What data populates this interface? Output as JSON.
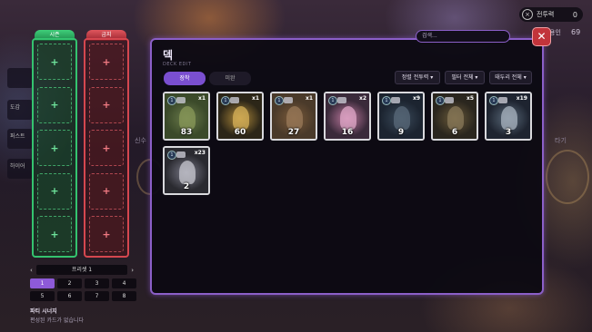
{
  "hud": {
    "currency_label": "전투력",
    "currency_value": "0",
    "side_label": "용인",
    "side_value": "69",
    "side_mid": "신수",
    "side_right": "타기"
  },
  "side_menu": [
    "",
    "도감",
    "퍼스트",
    "하이어"
  ],
  "columns": {
    "left_label": "시즌",
    "right_label": "금지",
    "slot_symbol": "+",
    "slot_count": 5
  },
  "preset": {
    "prev": "‹",
    "name": "프리셋 1",
    "next": "›"
  },
  "pages": [
    "1",
    "2",
    "3",
    "4",
    "5",
    "6",
    "7",
    "8"
  ],
  "active_page": "1",
  "footer": {
    "title": "파티 시너지",
    "subtitle": "편성된 카드가 없습니다"
  },
  "panel": {
    "title": "덱",
    "subtitle": "DECK EDIT",
    "search_placeholder": "검색...",
    "close": "✕",
    "tabs": [
      "장착",
      "미완"
    ],
    "filters": [
      "정렬 전투력 ▾",
      "필터 전체 ▾",
      "태두리 전체 ▾"
    ]
  },
  "cards": [
    {
      "power": "83",
      "qty": "x1",
      "theme": "tree"
    },
    {
      "power": "60",
      "qty": "x1",
      "theme": "serpent"
    },
    {
      "power": "27",
      "qty": "x1",
      "theme": "totem"
    },
    {
      "power": "16",
      "qty": "x2",
      "theme": "maiden"
    },
    {
      "power": "9",
      "qty": "x9",
      "theme": "beast"
    },
    {
      "power": "6",
      "qty": "x5",
      "theme": "golem"
    },
    {
      "power": "3",
      "qty": "x19",
      "theme": "ghost-rider"
    },
    {
      "power": "2",
      "qty": "x23",
      "theme": "specter"
    }
  ],
  "card_cost_label": "1",
  "colors": {
    "accent": "#8b5fc8",
    "green": "#34c36f",
    "red": "#d5474f",
    "close": "#c2343b"
  }
}
